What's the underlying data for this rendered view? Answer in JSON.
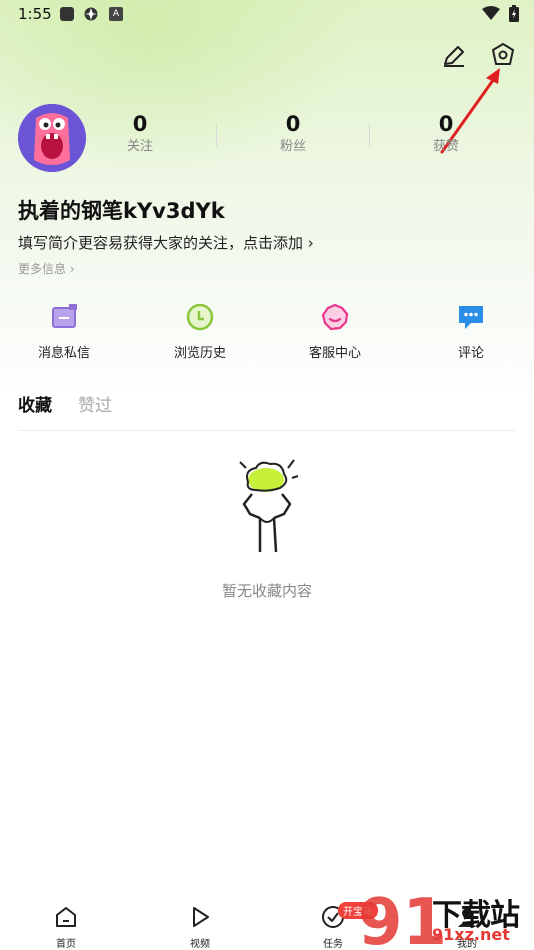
{
  "status_bar": {
    "time": "1:55",
    "badge_letter": "A"
  },
  "profile": {
    "username": "执着的钢笔kYv3dYk",
    "bio": "填写简介更容易获得大家的关注，点击添加 ›",
    "more_info": "更多信息 ›",
    "stats": [
      {
        "value": "0",
        "label": "关注"
      },
      {
        "value": "0",
        "label": "粉丝"
      },
      {
        "value": "0",
        "label": "获赞"
      }
    ]
  },
  "shortcuts": [
    {
      "label": "消息私信",
      "icon": "message-box-icon",
      "color": "#8f6fd6"
    },
    {
      "label": "浏览历史",
      "icon": "clock-icon",
      "color": "#8cc63f"
    },
    {
      "label": "客服中心",
      "icon": "service-face-icon",
      "color": "#e8348b"
    },
    {
      "label": "评论",
      "icon": "comment-bubble-icon",
      "color": "#2a8de8"
    }
  ],
  "tabs": [
    {
      "label": "收藏",
      "active": true
    },
    {
      "label": "赞过",
      "active": false
    }
  ],
  "empty_state": {
    "text": "暂无收藏内容"
  },
  "bottom_nav": [
    {
      "label": "首页",
      "icon": "home-icon"
    },
    {
      "label": "视频",
      "icon": "play-icon"
    },
    {
      "label": "任务",
      "icon": "check-circle-icon",
      "badge": "开宝箱"
    },
    {
      "label": "我的",
      "icon": "person-icon"
    }
  ],
  "watermark": {
    "title": "下载站",
    "url": "91xz.net",
    "logo_text": "91"
  },
  "colors": {
    "accent_green": "#c4e896",
    "arrow_red": "#e02020",
    "badge_red": "#f0413a"
  }
}
